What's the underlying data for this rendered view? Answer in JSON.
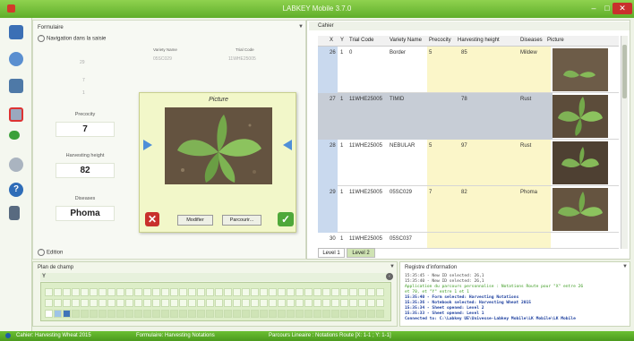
{
  "window": {
    "title": "LABKEY Mobile 3.7.0"
  },
  "toolbar": {
    "icons": [
      "notebook-icon",
      "sync-icon",
      "database-icon",
      "delete-icon",
      "tag-icon",
      "settings-icon",
      "help-icon",
      "exit-icon"
    ]
  },
  "form": {
    "panel_label": "Formulaire",
    "nav_label": "Navigation dans la saisie",
    "col_variety": "Variety Name",
    "col_trial": "Trial Code",
    "faint_values": [
      "29",
      "05SC029",
      "11WHE25005",
      "7",
      "1"
    ],
    "fields": [
      {
        "label": "Precocity",
        "value": "7"
      },
      {
        "label": "Harvesting height",
        "value": "82"
      },
      {
        "label": "Diseases",
        "value": "Phoma"
      }
    ],
    "edition_label": "Edition"
  },
  "picture_dialog": {
    "title": "Picture",
    "modify_label": "Modifier",
    "browse_label": "Parcourir..."
  },
  "grid": {
    "caption": "Cahier",
    "columns": [
      "X",
      "Y",
      "Trial Code",
      "Variety Name",
      "Precocity",
      "Harvesting height",
      "Diseases",
      "Picture"
    ],
    "rows": [
      {
        "x": "26",
        "y": "1",
        "trial": "0",
        "variety": "Border",
        "precocity": "5",
        "height": "85",
        "disease": "Mildew",
        "selected": false
      },
      {
        "x": "27",
        "y": "1",
        "trial": "11WHE25005",
        "variety": "TIMID",
        "precocity": "",
        "height": "78",
        "disease": "Rust",
        "selected": true
      },
      {
        "x": "28",
        "y": "1",
        "trial": "11WHE25005",
        "variety": "NEBULAR",
        "precocity": "5",
        "height": "97",
        "disease": "Rust",
        "selected": false
      },
      {
        "x": "29",
        "y": "1",
        "trial": "11WHE25005",
        "variety": "05SC029",
        "precocity": "7",
        "height": "82",
        "disease": "Phoma",
        "selected": false
      },
      {
        "x": "30",
        "y": "1",
        "trial": "11WHE25005",
        "variety": "05SC037",
        "precocity": "",
        "height": "",
        "disease": "",
        "selected": false
      }
    ],
    "tabs": [
      "Level 1",
      "Level 2"
    ],
    "active_tab": 1
  },
  "plan": {
    "label": "Plan de champ",
    "row_marker": "Y"
  },
  "log": {
    "label": "Registre d'information",
    "lines": [
      {
        "text": "15:35:45 - New ID selected: 26,1",
        "color": "#444444"
      },
      {
        "text": "15:35:40 - New ID selected: 26,1",
        "color": "#444444"
      },
      {
        "text": "Application du parcours personnalise : Notations Route pour \"X\" entre 26",
        "color": "#3a9a1e"
      },
      {
        "text": "et 70, et \"Y\" entre 1 et 1",
        "color": "#3a9a1e"
      },
      {
        "text": "15:35:40 - Form selected: Harvesting Notations",
        "color": "#1d3f9e"
      },
      {
        "text": "15:35:36 - Notebook selected: Harvesting Wheat 2015",
        "color": "#1d3f9e"
      },
      {
        "text": "15:35:34 - Sheet opened: Level 2",
        "color": "#1d3f9e"
      },
      {
        "text": "15:35:33 - Sheet opened: Level 1",
        "color": "#1d3f9e"
      },
      {
        "text": "Connected to: C:\\Labkey UE\\Univesse-Labkey Mobile\\LK Mobile\\LK Mobile",
        "color": "#1d3f9e"
      }
    ]
  },
  "status": {
    "items": [
      "Cahier: Harvesting Wheat 2015",
      "Formulaire: Harvesting Notations",
      "Parcours Lineaire : Notations Route [X: 1-1 ; Y: 1-1]"
    ]
  },
  "colors": {
    "brand": "#6bbf33",
    "dialog": "#f2f7c9",
    "header_yellow": "#fbf6c9",
    "selected_row": "#c7cdd6"
  }
}
